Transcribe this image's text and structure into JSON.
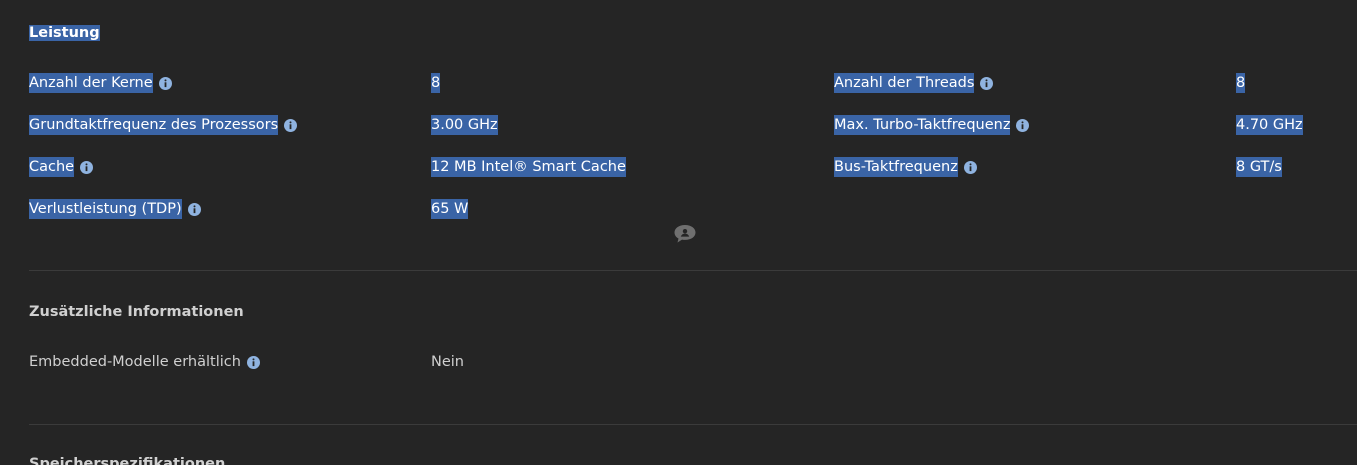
{
  "sections": {
    "performance": {
      "title": "Leistung",
      "rows": [
        {
          "label1": "Anzahl der Kerne",
          "value1": "8",
          "label2": "Anzahl der Threads",
          "value2": "8"
        },
        {
          "label1": "Grundtaktfrequenz des Prozessors",
          "value1": "3.00 GHz",
          "label2": "Max. Turbo-Taktfrequenz",
          "value2": "4.70 GHz"
        },
        {
          "label1": "Cache",
          "value1": "12 MB Intel® Smart Cache",
          "label2": "Bus-Taktfrequenz",
          "value2": "8 GT/s"
        },
        {
          "label1": "Verlustleistung (TDP)",
          "value1": "65 W"
        }
      ]
    },
    "additional": {
      "title": "Zusätzliche Informationen",
      "rows": [
        {
          "label1": "Embedded-Modelle erhältlich",
          "value1": "Nein"
        }
      ]
    },
    "memory": {
      "title": "Speicherspezifikationen"
    }
  },
  "colors": {
    "background": "#252525",
    "selection": "#3a64a6",
    "info_icon": "#8fb3e0"
  },
  "icons": {
    "info": "info-icon",
    "feedback": "chat-bubble-icon"
  }
}
